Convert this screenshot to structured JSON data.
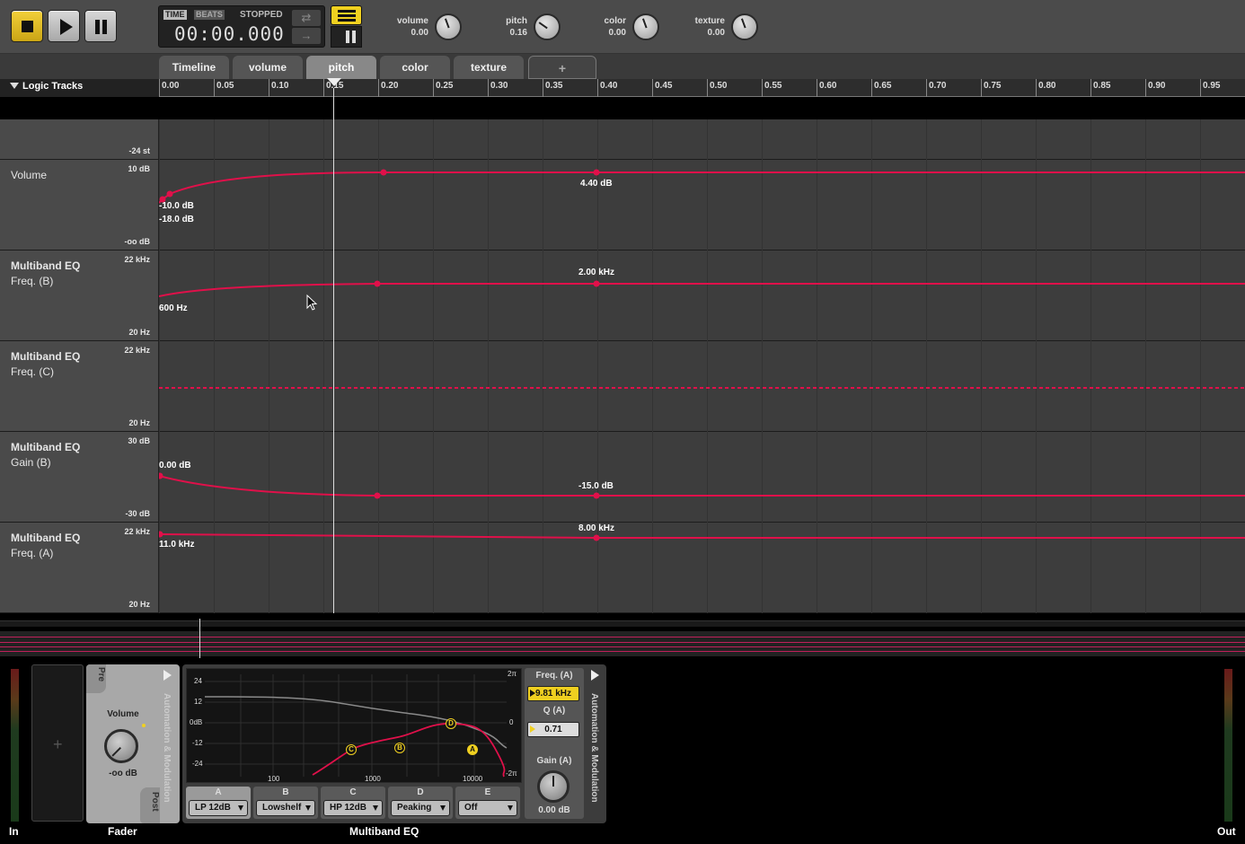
{
  "transport": {
    "time_chip": "TIME",
    "beats_chip": "BEATS",
    "status": "STOPPED",
    "clock": "00:00.000"
  },
  "macros": [
    {
      "label": "volume",
      "value": "0.00",
      "angle": -20
    },
    {
      "label": "pitch",
      "value": "0.16",
      "angle": -55
    },
    {
      "label": "color",
      "value": "0.00",
      "angle": -20
    },
    {
      "label": "texture",
      "value": "0.00",
      "angle": -20
    }
  ],
  "tabs": [
    "Timeline",
    "volume",
    "pitch",
    "color",
    "texture",
    "+"
  ],
  "active_tab": "pitch",
  "sidebar": {
    "header": "Logic Tracks"
  },
  "ruler": [
    "0.00",
    "0.05",
    "0.10",
    "0.15",
    "0.20",
    "0.25",
    "0.30",
    "0.35",
    "0.40",
    "0.45",
    "0.50",
    "0.55",
    "0.60",
    "0.65",
    "0.70",
    "0.75",
    "0.80",
    "0.85",
    "0.90",
    "0.95"
  ],
  "tracks": [
    {
      "name": "",
      "sub": "",
      "top": "",
      "bottom": "-24 st"
    },
    {
      "name": "Volume",
      "sub": "",
      "top": "10 dB",
      "bottom": "-oo dB",
      "labels": [
        "-10.0 dB",
        "-18.0 dB",
        "4.40 dB"
      ]
    },
    {
      "name": "Multiband EQ",
      "sub": "Freq. (B)",
      "top": "22 kHz",
      "bottom": "20 Hz",
      "labels": [
        "600 Hz",
        "2.00 kHz"
      ]
    },
    {
      "name": "Multiband EQ",
      "sub": "Freq. (C)",
      "top": "22 kHz",
      "bottom": "20 Hz",
      "labels": []
    },
    {
      "name": "Multiband EQ",
      "sub": "Gain (B)",
      "top": "30 dB",
      "bottom": "-30 dB",
      "labels": [
        "0.00 dB",
        "-15.0 dB"
      ]
    },
    {
      "name": "Multiband EQ",
      "sub": "Freq. (A)",
      "top": "22 kHz",
      "bottom": "20 Hz",
      "labels": [
        "11.0 kHz",
        "8.00 kHz"
      ]
    }
  ],
  "devices": {
    "in_label": "In",
    "out_label": "Out",
    "fader_label": "Fader",
    "eq_label": "Multiband EQ",
    "add": "+",
    "fader": {
      "pre": "Pre",
      "post": "Post",
      "volume_label": "Volume",
      "volume_value": "-oo dB",
      "automation": "Automation & Modulation"
    },
    "eq": {
      "y_labels": [
        "24",
        "12",
        "0dB",
        "-12",
        "-24"
      ],
      "x_labels": [
        "100",
        "1000",
        "10000"
      ],
      "right_labels": [
        "2π",
        "0",
        "-2π"
      ],
      "band_points": [
        "A",
        "B",
        "C",
        "D"
      ],
      "bands": [
        {
          "letter": "A",
          "type": "LP 12dB"
        },
        {
          "letter": "B",
          "type": "Lowshelf"
        },
        {
          "letter": "C",
          "type": "HP 12dB"
        },
        {
          "letter": "D",
          "type": "Peaking"
        },
        {
          "letter": "E",
          "type": "Off"
        }
      ],
      "freq_label": "Freq. (A)",
      "freq_value": "9.81 kHz",
      "q_label": "Q (A)",
      "q_value": "0.71",
      "gain_label": "Gain (A)",
      "gain_value": "0.00 dB",
      "automation": "Automation & Modulation"
    }
  },
  "colors": {
    "accent": "#f0d020",
    "automation": "#e0104a",
    "background": "#3d3d3d"
  }
}
